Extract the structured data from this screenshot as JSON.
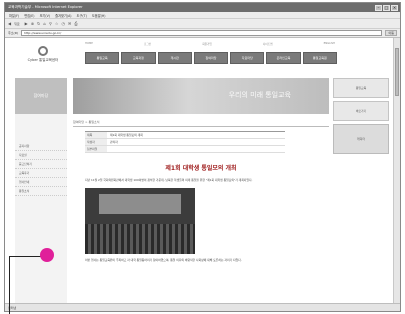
{
  "window": {
    "title": "교육과학기술부 - Microsoft Internet Explorer"
  },
  "menubar": {
    "items": [
      "파일(F)",
      "편집(E)",
      "보기(V)",
      "즐겨찾기(A)",
      "도구(T)",
      "도움말(H)"
    ]
  },
  "toolbar": {
    "back_label": "뒤로"
  },
  "addressbar": {
    "label": "주소(D)",
    "url": "http://www.uniedu.go.kr/",
    "go_label": "이동"
  },
  "site": {
    "logo_text": "Cyber 통일교육센터",
    "util_links": [
      "HOME",
      "로그인",
      "회원가입",
      "사이트맵",
      "ENGLISH"
    ],
    "nav_tabs": [
      "통일교육",
      "교육과정",
      "게시판",
      "참여마당",
      "자료마당",
      "온라인교육",
      "통일교육원"
    ],
    "banner_slogan": "우리의 미래 통일교육",
    "left_rail_title": "참여마당",
    "left_menu": [
      "공지사항",
      "자료실",
      "묻고답하기",
      "교육후기",
      "행사안내",
      "통일소식"
    ],
    "right_boxes": [
      "통일교육",
      "바로가기"
    ],
    "right_mascot": "캐릭터"
  },
  "article": {
    "breadcrumb": "참여마당 > 통일소식",
    "info": [
      {
        "k": "제목",
        "v": "제1회 대학생 통일모의 개최"
      },
      {
        "k": "작성자",
        "v": "관리자"
      },
      {
        "k": "첨부파일",
        "v": ""
      }
    ],
    "title": "제1회 대학생 통일모의 개최",
    "body1": "지난 11월 2일 국회의원회관에서 대학생 100여명이 참석한 가운데, 남북한 학생들의 미래 통일을 위한 \"제1회 대학생 통일모의\"가 개최되었다.",
    "body2": "이번 행사는 통일교육원이 주최하고 각 대학 통일동아리가 참여하였으며, 통일 이후의 바람직한 사회상에 대해 토론하는 자리가 되었다."
  },
  "statusbar": {
    "text": "인터넷"
  }
}
